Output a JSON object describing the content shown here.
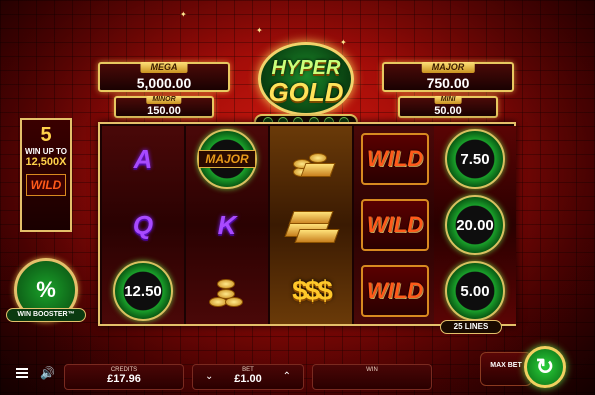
{
  "jackpots": {
    "mega": {
      "label": "MEGA",
      "value": "5,000.00"
    },
    "minor": {
      "label": "MINOR",
      "value": "150.00"
    },
    "major": {
      "label": "MAJOR",
      "value": "750.00"
    },
    "mini": {
      "label": "MINI",
      "value": "50.00"
    }
  },
  "logo": {
    "line1": "HYPER",
    "line2": "GOLD"
  },
  "promo": {
    "number": "5",
    "label": "WIN UP TO",
    "value": "12,500X",
    "wild": "WILD"
  },
  "booster": {
    "icon": "%",
    "label": "WIN BOOSTER™"
  },
  "reels": [
    [
      "A",
      "Q",
      "12.50"
    ],
    [
      "MAJOR",
      "K",
      "coins"
    ],
    [
      "coins-stack",
      "gold-bars",
      "$$$"
    ],
    [
      "WILD",
      "WILD",
      "WILD"
    ],
    [
      "7.50",
      "20.00",
      "5.00"
    ]
  ],
  "lines": "25 LINES",
  "bottom": {
    "credits_label": "CREDITS",
    "credits_value": "£17.96",
    "bet_label": "BET",
    "bet_value": "£1.00",
    "win_label": "WIN",
    "win_value": "",
    "maxbet_label": "MAX BET"
  },
  "colors": {
    "accent_gold": "#e4c06a",
    "chip_green": "#1aa02a",
    "wild_orange": "#ff5a1a",
    "background_red": "#a00c08"
  }
}
